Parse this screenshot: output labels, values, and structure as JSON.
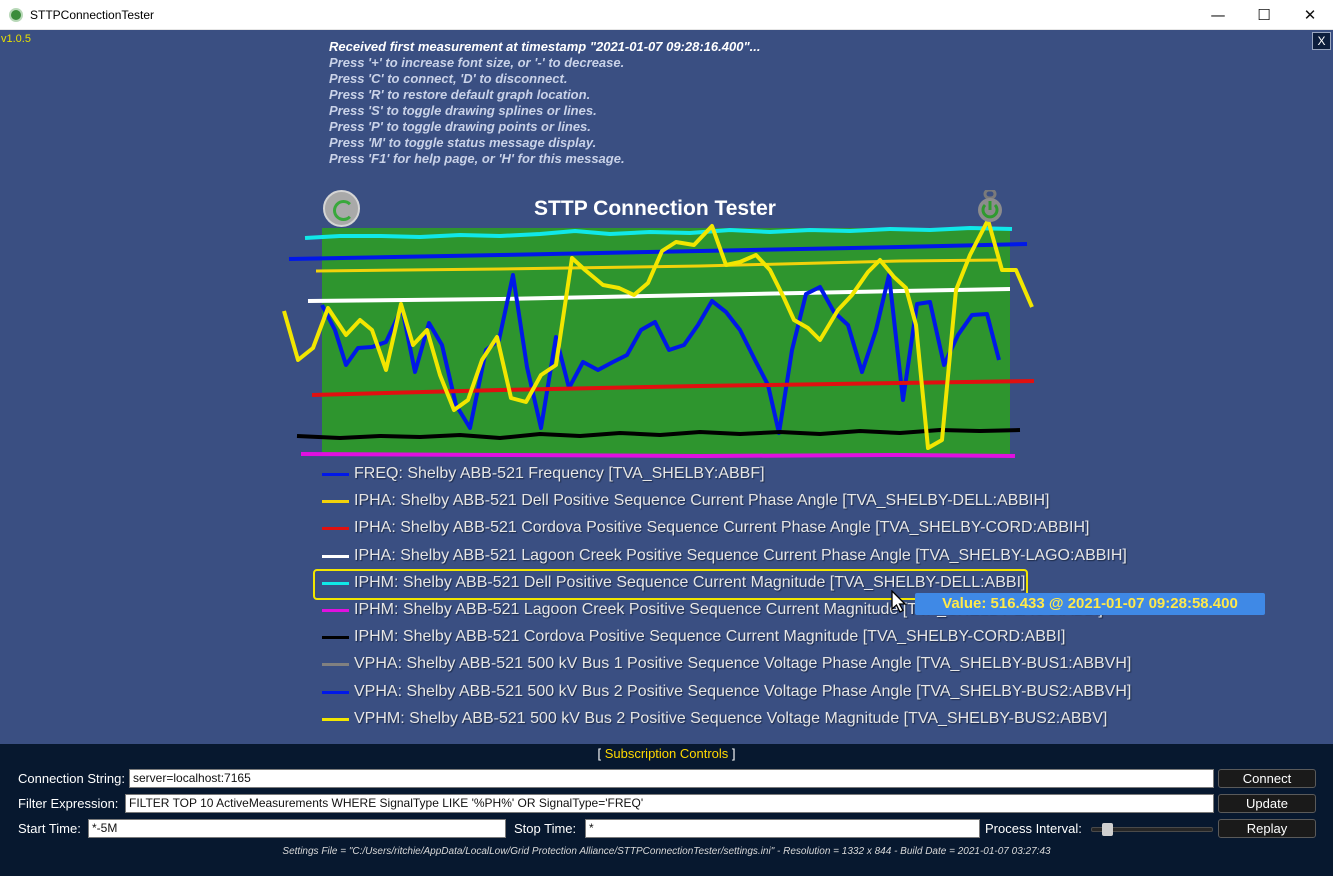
{
  "window": {
    "title": "STTPConnectionTester",
    "minimize_glyph": "—",
    "maximize_glyph": "☐",
    "close_glyph": "✕"
  },
  "version": "v1.0.5",
  "close_overlay_label": "X",
  "status_messages": [
    "Received first measurement at timestamp \"2021-01-07 09:28:16.400\"...",
    "Press '+' to increase font size, or '-' to decrease.",
    "Press 'C' to connect, 'D' to disconnect.",
    "Press 'R' to restore default graph location.",
    "Press 'S' to toggle drawing splines or lines.",
    "Press 'P' to toggle drawing points or lines.",
    "Press 'M' to toggle status message display.",
    "Press 'F1' for help page, or 'H' for this message."
  ],
  "graph": {
    "title": "STTP Connection Tester",
    "plot_background": "#2e952e",
    "page_background": "#3a4f82",
    "connect_icon": "connect-icon",
    "power_icon": "power-icon"
  },
  "legend": [
    {
      "color": "#0018e8",
      "label": "FREQ: Shelby ABB-521 Frequency [TVA_SHELBY:ABBF]"
    },
    {
      "color": "#f2d20a",
      "label": "IPHA: Shelby ABB-521 Dell Positive Sequence Current Phase Angle [TVA_SHELBY-DELL:ABBIH]"
    },
    {
      "color": "#e01010",
      "label": "IPHA: Shelby ABB-521 Cordova Positive Sequence Current Phase Angle [TVA_SHELBY-CORD:ABBIH]"
    },
    {
      "color": "#ffffff",
      "label": "IPHA: Shelby ABB-521 Lagoon Creek Positive Sequence Current Phase Angle [TVA_SHELBY-LAGO:ABBIH]"
    },
    {
      "color": "#10e8e8",
      "label": "IPHM: Shelby ABB-521 Dell Positive Sequence Current Magnitude [TVA_SHELBY-DELL:ABBI]"
    },
    {
      "color": "#e010e0",
      "label": "IPHM: Shelby ABB-521 Lagoon Creek Positive Sequence Current Magnitude [TVA_SHELBY-LAGO:ABBI]"
    },
    {
      "color": "#000000",
      "label": "IPHM: Shelby ABB-521 Cordova Positive Sequence Current Magnitude [TVA_SHELBY-CORD:ABBI]"
    },
    {
      "color": "#808080",
      "label": "VPHA: Shelby ABB-521 500 kV Bus 1 Positive Sequence Voltage Phase Angle [TVA_SHELBY-BUS1:ABBVH]"
    },
    {
      "color": "#0018e8",
      "label": "VPHA: Shelby ABB-521 500 kV Bus 2 Positive Sequence Voltage Phase Angle [TVA_SHELBY-BUS2:ABBVH]"
    },
    {
      "color": "#f2e600",
      "label": "VPHM: Shelby ABB-521 500 kV Bus 2 Positive Sequence Voltage Magnitude [TVA_SHELBY-BUS2:ABBV]"
    }
  ],
  "highlight_color": "#f2e600",
  "tooltip": "Value: 516.433 @ 2021-01-07 09:28:58.400",
  "controls": {
    "header_left": "[ ",
    "header_title": "Subscription Controls",
    "header_right": " ]",
    "connection_label": "Connection String:",
    "connection_value": "server=localhost:7165",
    "connect_button": "Connect",
    "filter_label": "Filter Expression:",
    "filter_value": "FILTER TOP 10 ActiveMeasurements WHERE SignalType LIKE '%PH%' OR SignalType='FREQ'",
    "update_button": "Update",
    "start_label": "Start Time:",
    "start_value": "*-5M",
    "stop_label": "Stop Time:",
    "stop_value": "*",
    "interval_label": "Process Interval:",
    "interval_level": 0.1,
    "replay_button": "Replay",
    "settings_info": "Settings File = \"C:/Users/ritchie/AppData/LocalLow/Grid Protection Alliance/STTPConnectionTester/settings.ini\" - Resolution = 1332 x 844 - Build Date = 2021-01-07 03:27:43"
  }
}
